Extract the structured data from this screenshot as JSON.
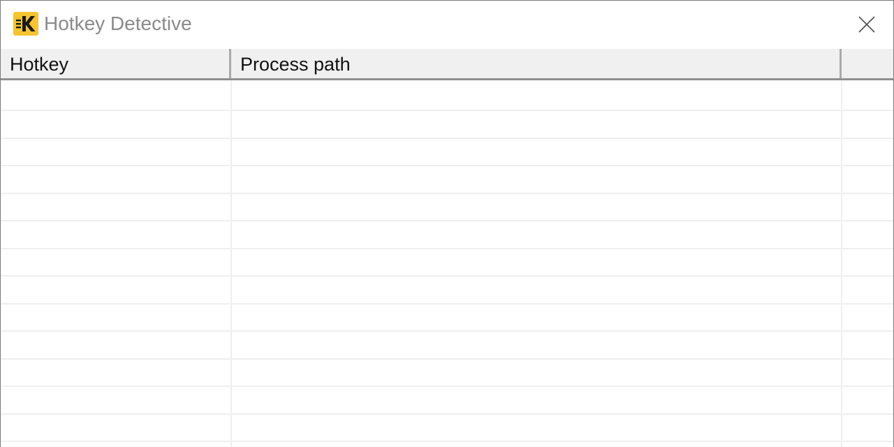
{
  "window": {
    "title": "Hotkey Detective",
    "icon": "hotkey-detective-app-icon",
    "icon_color": "#f6c431"
  },
  "listview": {
    "columns": [
      {
        "label": "Hotkey"
      },
      {
        "label": "Process path"
      },
      {
        "label": ""
      }
    ],
    "rows": []
  }
}
